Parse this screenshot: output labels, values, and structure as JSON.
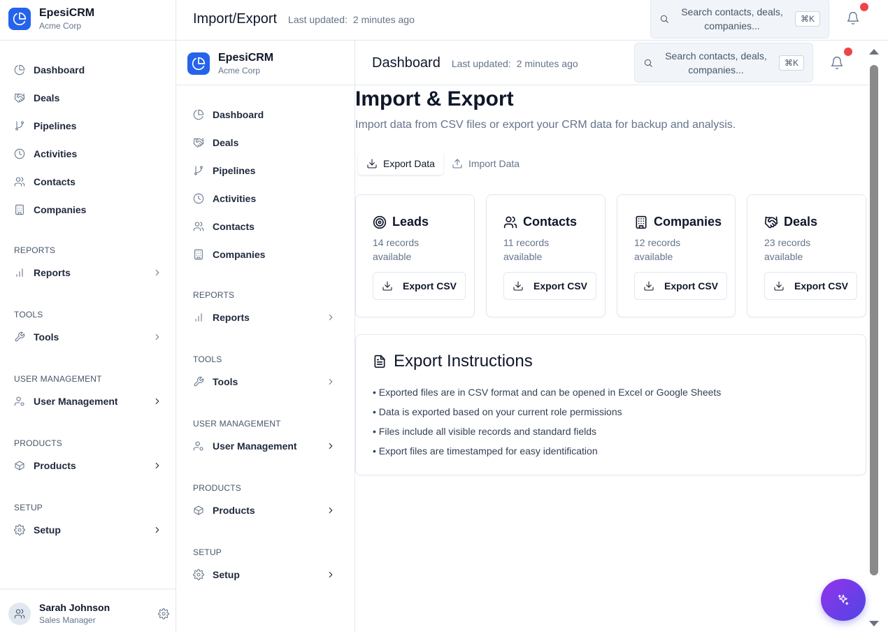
{
  "app": {
    "name": "EpesiCRM",
    "org": "Acme Corp"
  },
  "outer_header": {
    "title": "Import/Export",
    "updated_label": "Last updated:",
    "updated_value": "2 minutes ago"
  },
  "inner_header": {
    "title": "Dashboard",
    "updated_label": "Last updated:",
    "updated_value": "2 minutes ago"
  },
  "search": {
    "placeholder": "Search contacts, deals, companies...",
    "shortcut": "⌘K"
  },
  "nav": {
    "main": [
      {
        "label": "Dashboard",
        "icon": "dashboard-icon"
      },
      {
        "label": "Deals",
        "icon": "handshake-icon"
      },
      {
        "label": "Pipelines",
        "icon": "git-branch-icon"
      },
      {
        "label": "Activities",
        "icon": "clock-icon"
      },
      {
        "label": "Contacts",
        "icon": "users-icon"
      },
      {
        "label": "Companies",
        "icon": "building-icon"
      }
    ],
    "sections": [
      {
        "heading": "REPORTS",
        "item": "Reports",
        "icon": "bar-chart-icon"
      },
      {
        "heading": "TOOLS",
        "item": "Tools",
        "icon": "wrench-icon"
      },
      {
        "heading": "USER MANAGEMENT",
        "item": "User Management",
        "icon": "user-cog-icon"
      },
      {
        "heading": "PRODUCTS",
        "item": "Products",
        "icon": "package-icon"
      },
      {
        "heading": "SETUP",
        "item": "Setup",
        "icon": "gear-icon"
      }
    ]
  },
  "user": {
    "name": "Sarah Johnson",
    "role": "Sales Manager"
  },
  "page": {
    "title": "Import & Export",
    "subtitle": "Import data from CSV files or export your CRM data for backup and analysis.",
    "tabs": [
      {
        "label": "Export Data",
        "active": true
      },
      {
        "label": "Import Data",
        "active": false
      }
    ]
  },
  "export_cards": [
    {
      "title": "Leads",
      "count": "14 records",
      "avail": "available",
      "button": "Export CSV",
      "icon": "target-icon"
    },
    {
      "title": "Contacts",
      "count": "11 records",
      "avail": "available",
      "button": "Export CSV",
      "icon": "users-icon"
    },
    {
      "title": "Companies",
      "count": "12 records",
      "avail": "available",
      "button": "Export CSV",
      "icon": "building-icon"
    },
    {
      "title": "Deals",
      "count": "23 records",
      "avail": "available",
      "button": "Export CSV",
      "icon": "handshake-icon"
    }
  ],
  "instructions": {
    "title": "Export Instructions",
    "items": [
      "• Exported files are in CSV format and can be opened in Excel or Google Sheets",
      "• Data is exported based on your current role permissions",
      "• Files include all visible records and standard fields",
      "• Export files are timestamped for easy identification"
    ]
  },
  "colors": {
    "accent": "#2563eb",
    "notification": "#ef4444",
    "fab_start": "#9333ea",
    "fab_end": "#4f46e5"
  }
}
